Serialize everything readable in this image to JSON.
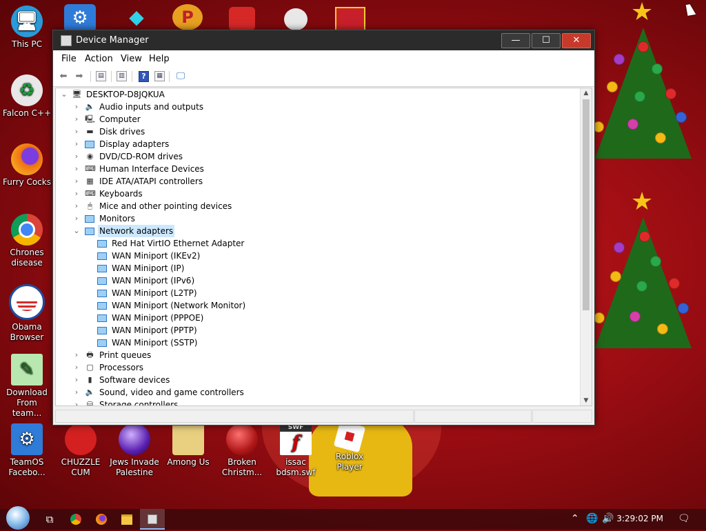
{
  "desktop": {
    "left_icons": [
      {
        "label": "This PC"
      },
      {
        "label": "Falcon C++"
      },
      {
        "label": "Furry Cocks"
      },
      {
        "label": "Chrones disease"
      },
      {
        "label": "Obama Browser"
      },
      {
        "label": "Download From team..."
      },
      {
        "label": "TeamOS Facebo..."
      }
    ],
    "bottom_icons": [
      {
        "label": "CHUZZLE CUM"
      },
      {
        "label": "Jews Invade Palestine"
      },
      {
        "label": "Among Us"
      },
      {
        "label": "Broken Christm..."
      },
      {
        "label": "issac bdsm.swf"
      },
      {
        "label": "Roblox Player"
      }
    ],
    "swf_badge": "SWF"
  },
  "window": {
    "title": "Device Manager",
    "minimize": "—",
    "maximize": "☐",
    "close": "✕",
    "menu": [
      "File",
      "Action",
      "View",
      "Help"
    ],
    "toolbar_help": "?"
  },
  "device_tree": {
    "root": "DESKTOP-D8JQKUA",
    "categories": [
      {
        "label": "Audio inputs and outputs",
        "icon": "speaker-icon"
      },
      {
        "label": "Computer",
        "icon": "computer-icon"
      },
      {
        "label": "Disk drives",
        "icon": "disk-drive-icon"
      },
      {
        "label": "Display adapters",
        "icon": "display-adapter-icon"
      },
      {
        "label": "DVD/CD-ROM drives",
        "icon": "dvd-drive-icon"
      },
      {
        "label": "Human Interface Devices",
        "icon": "hid-icon"
      },
      {
        "label": "IDE ATA/ATAPI controllers",
        "icon": "ide-controller-icon"
      },
      {
        "label": "Keyboards",
        "icon": "keyboard-icon"
      },
      {
        "label": "Mice and other pointing devices",
        "icon": "mouse-icon"
      },
      {
        "label": "Monitors",
        "icon": "monitor-icon"
      },
      {
        "label": "Network adapters",
        "icon": "network-adapter-icon",
        "expanded": true,
        "selected": true
      }
    ],
    "network_children": [
      "Red Hat VirtIO Ethernet Adapter",
      "WAN Miniport (IKEv2)",
      "WAN Miniport (IP)",
      "WAN Miniport (IPv6)",
      "WAN Miniport (L2TP)",
      "WAN Miniport (Network Monitor)",
      "WAN Miniport (PPPOE)",
      "WAN Miniport (PPTP)",
      "WAN Miniport (SSTP)"
    ],
    "after_categories": [
      {
        "label": "Print queues",
        "icon": "printer-icon"
      },
      {
        "label": "Processors",
        "icon": "processor-icon"
      },
      {
        "label": "Software devices",
        "icon": "software-device-icon"
      },
      {
        "label": "Sound, video and game controllers",
        "icon": "sound-controller-icon"
      },
      {
        "label": "Storage controllers",
        "icon": "storage-controller-icon"
      }
    ]
  },
  "taskbar": {
    "time": "3:29:02 PM"
  }
}
